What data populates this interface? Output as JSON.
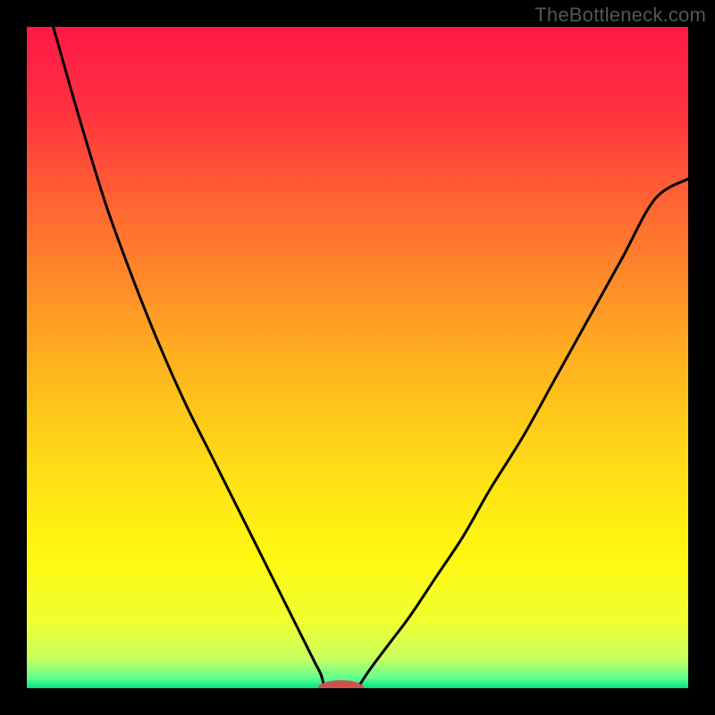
{
  "watermark": "TheBottleneck.com",
  "chart_data": {
    "type": "line",
    "title": "",
    "xlabel": "",
    "ylabel": "",
    "xlim": [
      0,
      100
    ],
    "ylim": [
      0,
      100
    ],
    "background_gradient_stops": [
      {
        "offset": 0.0,
        "color": "#ff1947"
      },
      {
        "offset": 0.12,
        "color": "#ff3040"
      },
      {
        "offset": 0.3,
        "color": "#ff7030"
      },
      {
        "offset": 0.5,
        "color": "#ffb020"
      },
      {
        "offset": 0.68,
        "color": "#ffe015"
      },
      {
        "offset": 0.8,
        "color": "#fff810"
      },
      {
        "offset": 0.9,
        "color": "#f0ff30"
      },
      {
        "offset": 0.955,
        "color": "#c8ff60"
      },
      {
        "offset": 0.985,
        "color": "#60ff90"
      },
      {
        "offset": 1.0,
        "color": "#00e080"
      }
    ],
    "series": [
      {
        "name": "left-branch",
        "x": [
          4,
          8,
          12,
          16,
          20,
          24,
          28,
          32,
          35,
          38,
          40,
          42,
          43.5,
          44.5,
          45
        ],
        "y": [
          100,
          86,
          73,
          62,
          52,
          43,
          35,
          27,
          21,
          15,
          11,
          7,
          4,
          2,
          0
        ]
      },
      {
        "name": "right-branch",
        "x": [
          50,
          52,
          55,
          58,
          62,
          66,
          70,
          75,
          80,
          85,
          90,
          95,
          100
        ],
        "y": [
          0,
          3,
          7,
          11,
          17,
          23,
          30,
          38,
          47,
          56,
          65,
          74,
          77
        ]
      }
    ],
    "marker": {
      "name": "min-marker",
      "cx": 47.5,
      "cy": 0,
      "rx": 3.5,
      "ry": 1.2,
      "color": "#d05050"
    }
  }
}
